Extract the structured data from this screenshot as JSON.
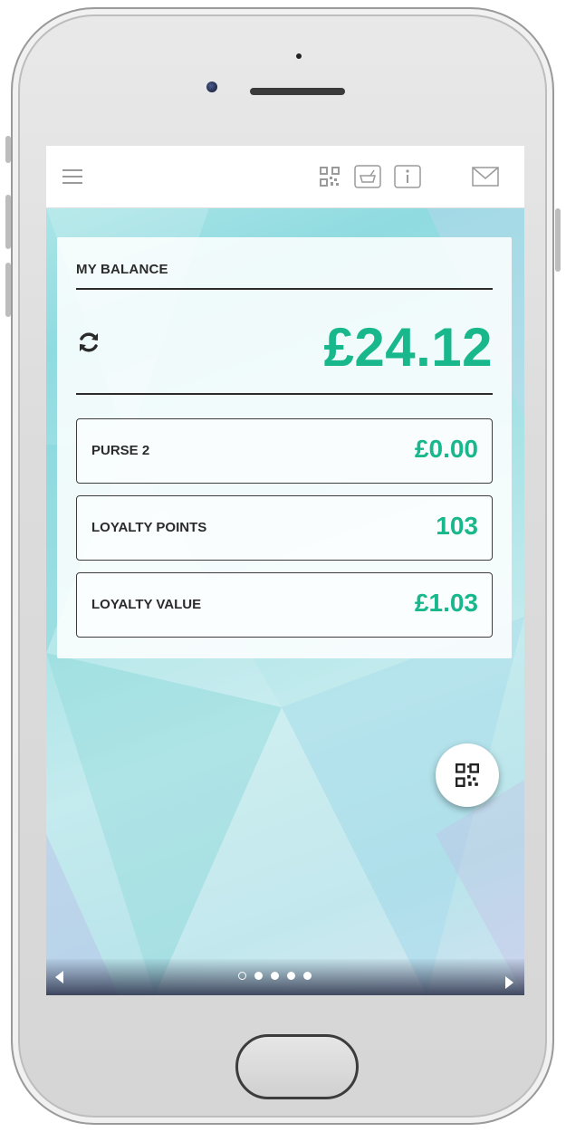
{
  "toolbar": {
    "icons": [
      "menu-icon",
      "qr-code-icon",
      "basket-icon",
      "info-icon",
      "mail-icon"
    ]
  },
  "balance_card": {
    "title": "MY BALANCE",
    "amount": "£24.12",
    "rows": [
      {
        "label": "PURSE 2",
        "value": "£0.00"
      },
      {
        "label": "LOYALTY POINTS",
        "value": "103"
      },
      {
        "label": "LOYALTY VALUE",
        "value": "£1.03"
      }
    ]
  },
  "pager": {
    "total": 5,
    "active_index": 0
  },
  "colors": {
    "accent": "#19b88c",
    "text": "#2b2b2b"
  }
}
